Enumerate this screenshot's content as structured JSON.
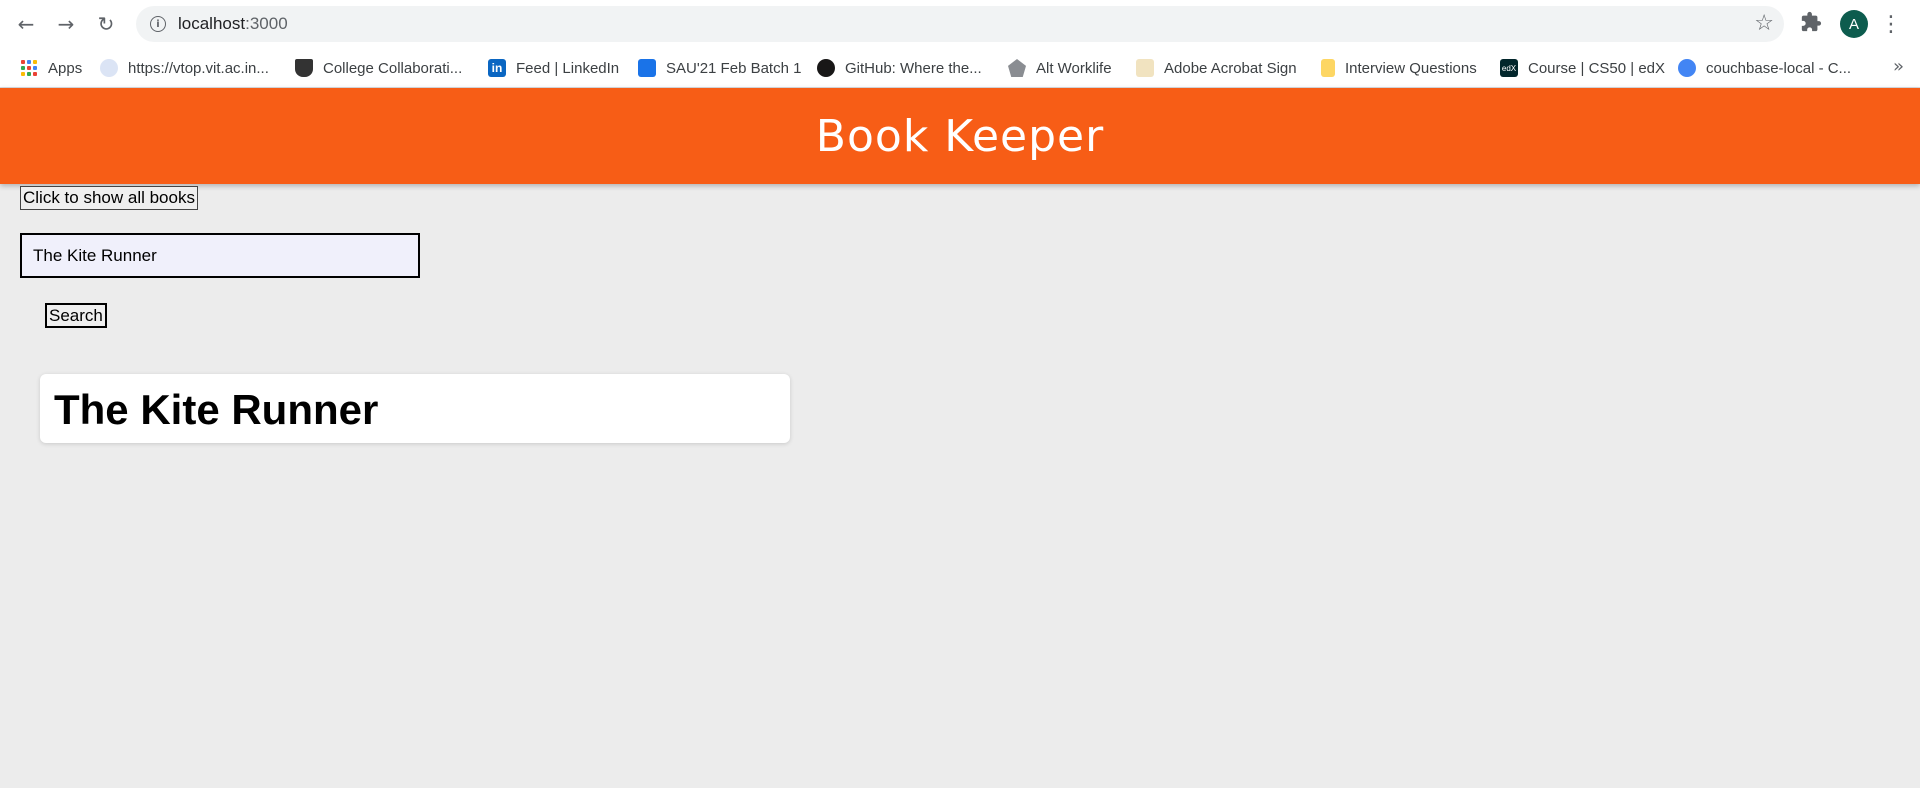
{
  "browser": {
    "url_host": "localhost",
    "url_port": ":3000",
    "avatar_letter": "A",
    "bookmarks": [
      {
        "label": "Apps",
        "icon": "apps-grid-icon"
      },
      {
        "label": "https://vtop.vit.ac.in...",
        "icon": "vit-logo-icon"
      },
      {
        "label": "College Collaborati...",
        "icon": "graduation-cap-icon"
      },
      {
        "label": "Feed | LinkedIn",
        "icon": "linkedin-icon"
      },
      {
        "label": "SAU'21 Feb Batch 1",
        "icon": "contact-card-icon"
      },
      {
        "label": "GitHub: Where the...",
        "icon": "github-icon"
      },
      {
        "label": "Alt Worklife",
        "icon": "pentagon-icon"
      },
      {
        "label": "Adobe Acrobat Sign",
        "icon": "signature-icon"
      },
      {
        "label": "Interview Questions",
        "icon": "note-icon"
      },
      {
        "label": "Course | CS50 | edX",
        "icon": "edx-icon"
      },
      {
        "label": "couchbase-local - C...",
        "icon": "couchbase-icon"
      }
    ],
    "more_label": "»"
  },
  "header": {
    "title": "Book Keeper",
    "color": "#f75d16"
  },
  "controls": {
    "show_all_label": "Click to show all books",
    "search_value": "The Kite Runner",
    "search_label": "Search"
  },
  "results": [
    {
      "title": "The Kite Runner"
    }
  ]
}
